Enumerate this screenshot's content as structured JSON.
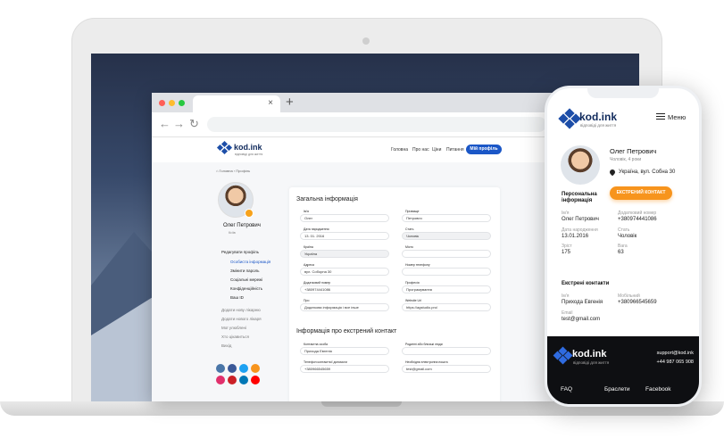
{
  "browser": {
    "tab_close": "×",
    "new_tab": "+",
    "nav_back": "←",
    "nav_forward": "→",
    "nav_reload": "↻"
  },
  "site": {
    "logo": "kod.ink",
    "tagline": "відповіді для життя",
    "nav": [
      "Головна",
      "Про нас",
      "Ціни",
      "Питання"
    ],
    "profile_button": "Мій профіль",
    "breadcrumb": "⌂ Головна › Профіль"
  },
  "sidebar": {
    "name": "Олег Петрович",
    "city": "Київ",
    "items": [
      {
        "label": "Редагувати профіль",
        "state": "normal"
      },
      {
        "label": "Особиста інформація",
        "state": "active"
      },
      {
        "label": "Змінити пароль",
        "state": "normal"
      },
      {
        "label": "Соціальні мережі",
        "state": "normal"
      },
      {
        "label": "Конфіденційність",
        "state": "normal"
      },
      {
        "label": "Ваш ID",
        "state": "normal"
      },
      {
        "label": "Додати нову лікарню",
        "state": "muted"
      },
      {
        "label": "Додати нового лікаря",
        "state": "muted"
      },
      {
        "label": "Мої улюблені",
        "state": "muted"
      },
      {
        "label": "Хто цікавиться",
        "state": "muted"
      },
      {
        "label": "Вихід",
        "state": "muted"
      }
    ],
    "social_colors": [
      "#4a76a8",
      "#3b5998",
      "#1da1f2",
      "#f7941d",
      "#e1306c",
      "#cb2027",
      "#0077b5",
      "#ff0000"
    ]
  },
  "form": {
    "section1": "Загальна інформація",
    "section2": "Інформація про екстрений контакт",
    "fields": {
      "first_name_label": "Ім'я",
      "first_name": "Олег",
      "last_name_label": "Прізвище",
      "last_name": "Петрович",
      "birth_label": "Дата народження",
      "birth": "13. 01. 2016",
      "gender_label": "Стать",
      "gender": "Чоловік",
      "country_label": "Країна",
      "country": "Україна",
      "city_label": "Місто",
      "city": "",
      "address_label": "Адреса",
      "address": "вул. Соборна 30",
      "home_phone_label": "Номер телефону",
      "home_phone": "",
      "extra_phone_label": "Додатковий номер",
      "extra_phone": "+380974441086",
      "profession_label": "Професія",
      "profession": "Програмування",
      "about_label": "Про",
      "about": "Додаткова інформація і все інше",
      "website_label": "Website Url",
      "website": "https://agstudio.pro/",
      "contact_person_label": "Контактна особа",
      "contact_person": "Прихода Евгенія",
      "relation_label": "Родинні або близькі люди",
      "relation": "",
      "contact_phone_label": "Телефон контактної допомоги",
      "contact_phone": "+380966545659",
      "contact_email_label": "Необхідна електронна пошта",
      "contact_email": "test@gmail.com"
    }
  },
  "phone": {
    "logo": "kod.ink",
    "tagline": "відповіді для життя",
    "menu": "Меню",
    "name": "Олег Петрович",
    "sub": "Чоловік, 4 роки",
    "location": "Україна, вул. Собна 30",
    "emergency_button": "ЕКСТРЕНИЙ КОНТАКТ",
    "personal_title": "Персональна інформація",
    "name_label": "Ім'я",
    "name_value": "Олег Петрович",
    "extra_label": "Додатковий номер",
    "extra_value": "+380974441086",
    "birth_label": "Дата народження",
    "birth_value": "13.01.2016",
    "gender_label": "Стать",
    "gender_value": "Чоловік",
    "height_label": "Зріст",
    "height_value": "175",
    "weight_label": "Вага",
    "weight_value": "63",
    "emergency_title": "Екстрені контакти",
    "contact_name_label": "Ім'я",
    "contact_name": "Приходa Евгенія",
    "mobile_label": "Мобільний",
    "mobile": "+380966545659",
    "email_label": "Email",
    "email": "test@gmail.com",
    "footer_logo": "kod.ink",
    "footer_tagline": "відповіді для життя",
    "footer_email": "support@kod.ink",
    "footer_phone": "+44 987 065 908",
    "footer_links": [
      "FAQ",
      "Браслети",
      "Facebook"
    ]
  }
}
